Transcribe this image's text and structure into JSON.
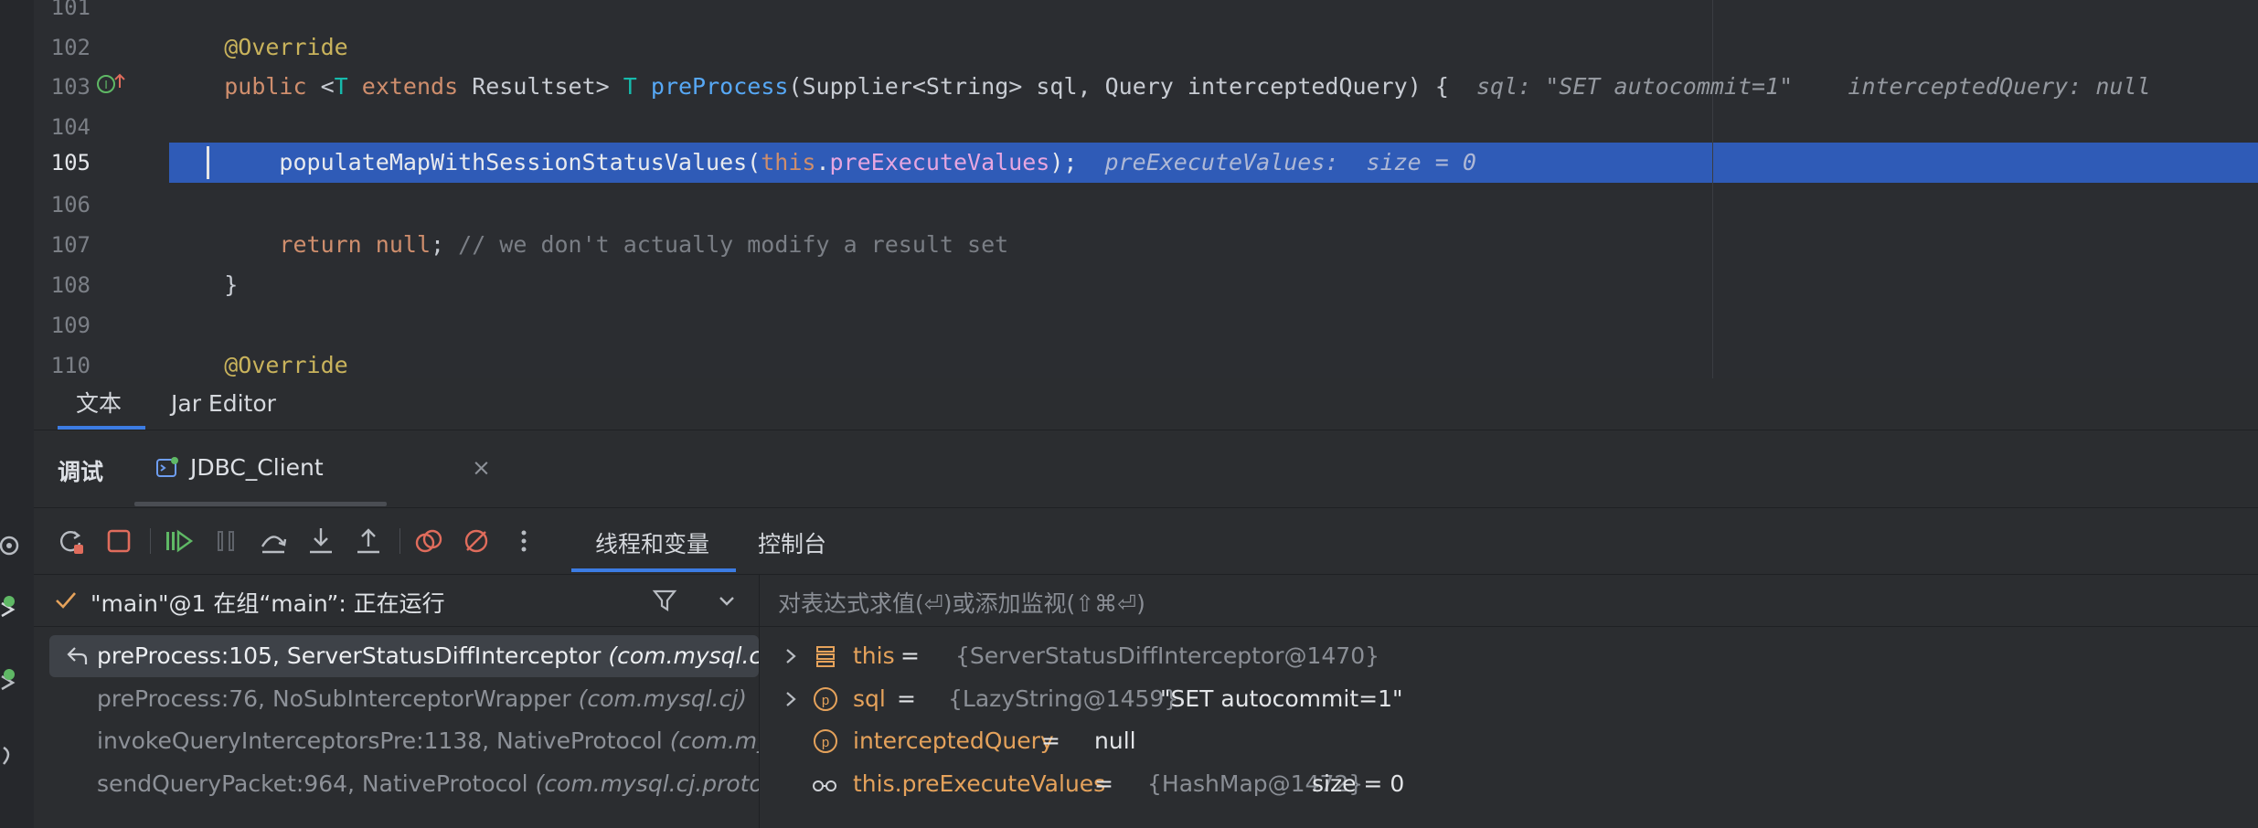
{
  "editor": {
    "lines": [
      {
        "num": "101"
      },
      {
        "num": "102",
        "annotation": "@Override"
      },
      {
        "num": "103",
        "kw_public": "public",
        "lt": "<",
        "tparam": "T",
        "kw_extends": "extends",
        "rs": "Resultset>",
        "tparam2": "T",
        "method": "preProcess",
        "params": "(Supplier<String> sql, Query interceptedQuery) {",
        "hint1": "sql: \"SET autocommit=1\"",
        "hint2": "interceptedQuery: null"
      },
      {
        "num": "104"
      },
      {
        "num": "105",
        "call": "populateMapWithSessionStatusValues(",
        "kw_this": "this",
        "dot": ".",
        "field": "preExecuteValues",
        "close": ");",
        "hint_name": "preExecuteValues:",
        "hint_val": "size = 0"
      },
      {
        "num": "106"
      },
      {
        "num": "107",
        "kw_return": "return",
        "kw_null": "null",
        "semi": ";",
        "comment": "// we don't actually modify a result set"
      },
      {
        "num": "108",
        "brace": "}"
      },
      {
        "num": "109"
      },
      {
        "num": "110",
        "annotation": "@Override"
      }
    ],
    "highlight_color": "#2f5bb7"
  },
  "editor_tabs": [
    {
      "label": "文本",
      "active": true
    },
    {
      "label": "Jar Editor",
      "active": false
    }
  ],
  "debug": {
    "title": "调试",
    "session_tab": "JDBC_Client",
    "session_close": "×",
    "toolbar": {
      "icons": [
        "rerun-icon",
        "stop-icon",
        "resume-icon",
        "pause-icon",
        "step-over-icon",
        "step-into-icon",
        "step-out-icon",
        "view-breakpoints-icon",
        "mute-breakpoints-icon",
        "more-icon"
      ],
      "tabs": [
        {
          "label": "线程和变量",
          "active": true
        },
        {
          "label": "控制台",
          "active": false
        }
      ]
    },
    "thread": {
      "text": "\"main\"@1 在组“main”: 正在运行"
    },
    "frames": [
      {
        "name": "preProcess:105, ServerStatusDiffInterceptor",
        "pkg": "(com.mysql.cj.",
        "selected": true
      },
      {
        "name": "preProcess:76, NoSubInterceptorWrapper",
        "pkg": "(com.mysql.cj)",
        "selected": false
      },
      {
        "name": "invokeQueryInterceptorsPre:1138, NativeProtocol",
        "pkg": "(com.mys",
        "selected": false
      },
      {
        "name": "sendQueryPacket:964, NativeProtocol",
        "pkg": "(com.mysql.cj.proto",
        "selected": false
      }
    ],
    "eval_placeholder": "对表达式求值(⏎)或添加监视(⇧⌘⏎)",
    "variables": [
      {
        "name": "this",
        "eq": " = ",
        "ref": "{ServerStatusDiffInterceptor@1470}",
        "value": "",
        "icon": "field-icon",
        "expandable": true
      },
      {
        "name": "sql",
        "eq": " = ",
        "ref": "{LazyString@1459}",
        "value": " \"SET autocommit=1\"",
        "icon": "parameter-icon",
        "expandable": true
      },
      {
        "name": "interceptedQuery",
        "eq": " = ",
        "ref": "",
        "value": "null",
        "icon": "parameter-icon",
        "expandable": false
      },
      {
        "name": "this.preExecuteValues",
        "eq": " = ",
        "ref": "{HashMap@1472}",
        "value": "  size = 0",
        "icon": "watch-icon",
        "expandable": false
      }
    ]
  }
}
